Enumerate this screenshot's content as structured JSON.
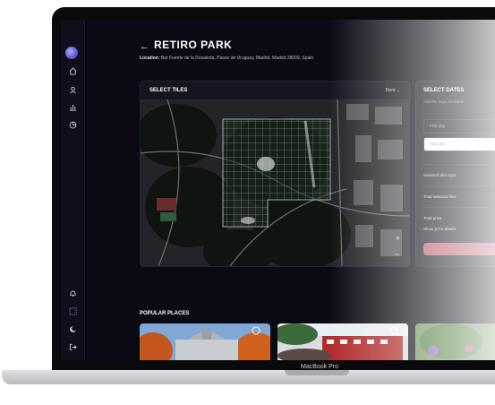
{
  "page": {
    "title": "RETIRO PARK",
    "location_label": "Location:",
    "location_value": "Bar Fuente de la Rosaleda, Paseo de Uruguay, Madrid, Madrid 28009, Spain"
  },
  "tiles_panel": {
    "heading": "SELECT TILES",
    "mode": "Rent",
    "mode_chevron": "⌄",
    "zoom_in": "+",
    "zoom_out": "−"
  },
  "dates_panel": {
    "heading": "SELECT DATES",
    "subtitle": "Add the days available",
    "first_day": "First day",
    "add_date": "Add date",
    "selected_tiles": "Selected tiles type",
    "total_tiles": "Total selected tiles",
    "total_price": "Total price",
    "show_price_details": "Show price details"
  },
  "popular": {
    "heading": "POPULAR PLACES"
  },
  "device": {
    "brand": "MacBook Pro"
  },
  "icons": [
    "back-arrow-icon",
    "logo-icon",
    "home-icon",
    "user-icon",
    "chart-icon",
    "pie-icon",
    "bell-icon",
    "grid-icon",
    "theme-icon",
    "logout-icon"
  ]
}
